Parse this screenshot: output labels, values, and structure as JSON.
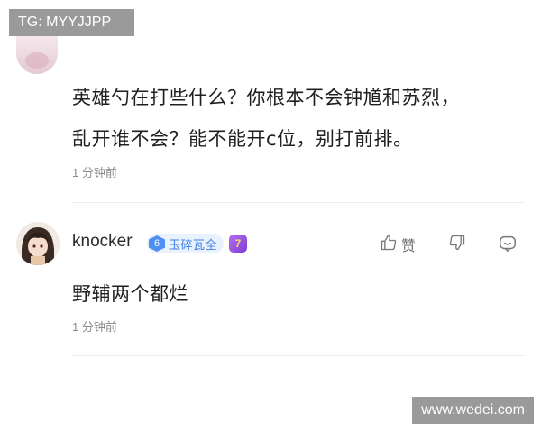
{
  "watermarks": {
    "top": "TG: MYYJJPP",
    "bottom": "www.wedei.com"
  },
  "comments": [
    {
      "lines": [
        "英雄勺在打些什么？你根本不会钟馗和苏烈，",
        "乱开谁不会？能不能开c位，别打前排。"
      ],
      "time": "1 分钟前"
    },
    {
      "username": "knocker",
      "rank": {
        "number": "6",
        "label": "玉碎瓦全"
      },
      "level": "7",
      "actions": {
        "like_label": "赞"
      },
      "text": "野辅两个都烂",
      "time": "1 分钟前"
    }
  ],
  "colors": {
    "rank_accent": "#4d8ff2",
    "level_badge": "#8b4be0",
    "muted_text": "#8a8a8a"
  }
}
